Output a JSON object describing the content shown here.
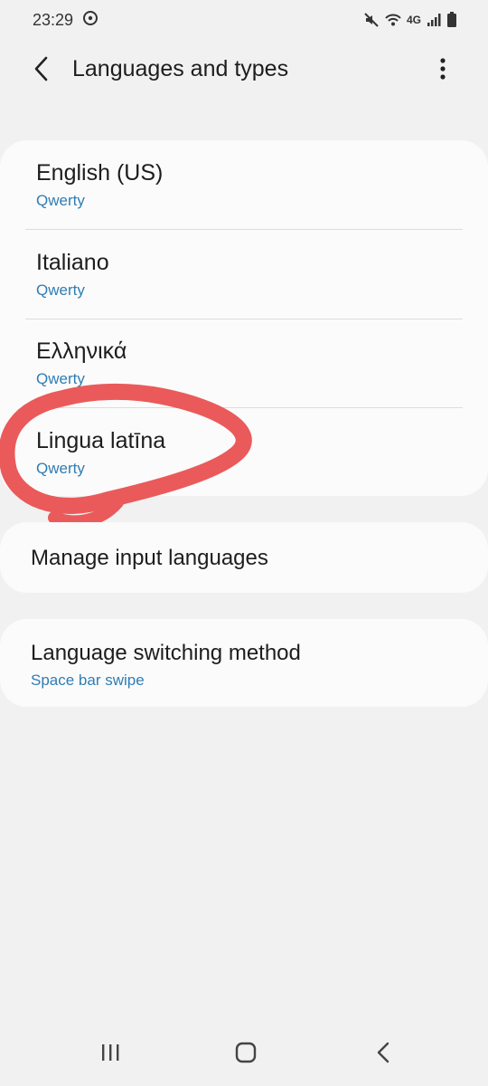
{
  "status_bar": {
    "time": "23:29",
    "icons": [
      "clock-circle-icon",
      "mute-icon",
      "wifi-icon",
      "4g-icon",
      "signal-icon",
      "battery-icon"
    ],
    "network": "4G"
  },
  "header": {
    "title": "Languages and types",
    "back_icon": "back-arrow-icon",
    "more_icon": "more-vertical-icon"
  },
  "languages": [
    {
      "name": "English (US)",
      "layout": "Qwerty"
    },
    {
      "name": "Italiano",
      "layout": "Qwerty"
    },
    {
      "name": "Ελληνικά",
      "layout": "Qwerty"
    },
    {
      "name": "Lingua latīna",
      "layout": "Qwerty"
    }
  ],
  "manage": {
    "label": "Manage input languages"
  },
  "switching": {
    "label": "Language switching method",
    "value": "Space bar swipe"
  },
  "colors": {
    "accent": "#2f7db5",
    "annotation": "#ea5a5a",
    "background": "#f1f1f1",
    "card": "#fbfbfb"
  },
  "nav": {
    "icons": [
      "recent-apps-icon",
      "home-icon",
      "back-icon"
    ]
  }
}
